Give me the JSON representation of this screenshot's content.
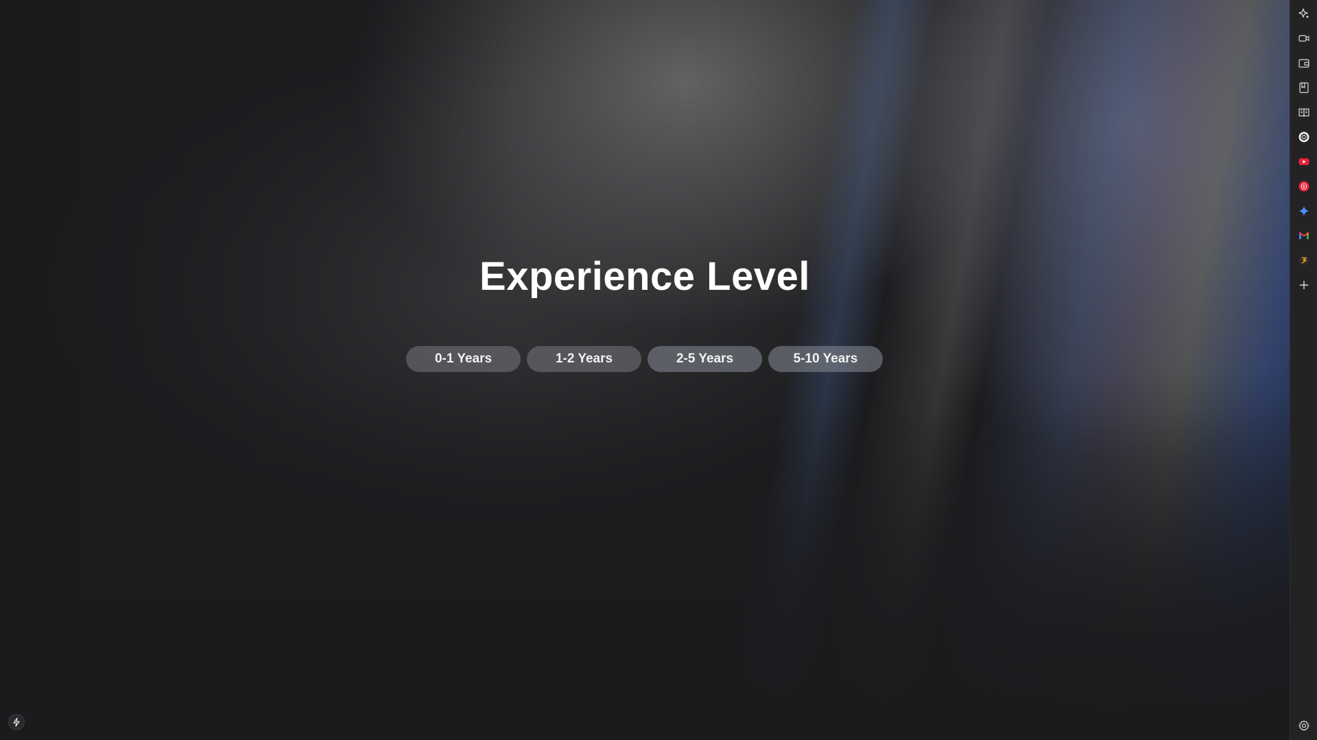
{
  "page": {
    "title": "Experience Level",
    "options": [
      "0-1 Years",
      "1-2 Years",
      "2-5 Years",
      "5-10 Years"
    ]
  },
  "sidebar": {
    "icons": [
      "ai-sparkle-icon",
      "video-camera-icon",
      "wallet-icon",
      "bookmark-icon",
      "reading-list-icon",
      "chatgpt-icon",
      "youtube-icon",
      "youtube-music-icon",
      "gemini-icon",
      "gmail-icon",
      "ai-assistant-icon",
      "add-icon",
      "settings-icon"
    ]
  },
  "corner": {
    "icon": "lightning-icon"
  },
  "colors": {
    "background": "#1b1b1e",
    "sidebar": "#232326",
    "youtube_red": "#e62138",
    "gemini_blue": "#4a8ff0"
  }
}
